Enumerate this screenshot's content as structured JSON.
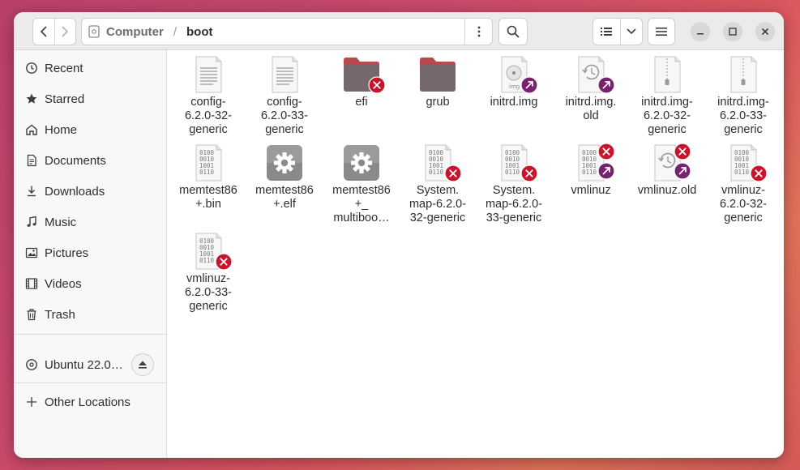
{
  "path": {
    "parent": "Computer",
    "current": "boot"
  },
  "sidebar": {
    "items": [
      {
        "label": "Recent",
        "icon": "clock-icon"
      },
      {
        "label": "Starred",
        "icon": "star-icon"
      },
      {
        "label": "Home",
        "icon": "home-icon"
      },
      {
        "label": "Documents",
        "icon": "document-icon"
      },
      {
        "label": "Downloads",
        "icon": "download-icon"
      },
      {
        "label": "Music",
        "icon": "music-note-icon"
      },
      {
        "label": "Pictures",
        "icon": "picture-icon"
      },
      {
        "label": "Videos",
        "icon": "film-icon"
      },
      {
        "label": "Trash",
        "icon": "trash-icon"
      }
    ],
    "drive": {
      "label": "Ubuntu 22.0…",
      "icon": "disc-icon"
    },
    "other": {
      "label": "Other Locations",
      "icon": "plus-icon"
    }
  },
  "files": [
    {
      "name": "config-\n6.2.0-32-\ngeneric",
      "type": "text"
    },
    {
      "name": "config-\n6.2.0-33-\ngeneric",
      "type": "text"
    },
    {
      "name": "efi",
      "type": "folder",
      "badges": [
        "unreadable"
      ]
    },
    {
      "name": "grub",
      "type": "folder",
      "badges": []
    },
    {
      "name": "initrd.img",
      "type": "image",
      "badges": [
        "symlink"
      ]
    },
    {
      "name": "initrd.img.\nold",
      "type": "backup",
      "badges": [
        "symlink"
      ]
    },
    {
      "name": "initrd.img-\n6.2.0-32-\ngeneric",
      "type": "archive"
    },
    {
      "name": "initrd.img-\n6.2.0-33-\ngeneric",
      "type": "archive"
    },
    {
      "name": "memtest86\n+.bin",
      "type": "binary"
    },
    {
      "name": "memtest86\n+.elf",
      "type": "executable"
    },
    {
      "name": "memtest86\n+_\nmultiboo…",
      "type": "executable"
    },
    {
      "name": "System.\nmap-6.2.0-\n32-generic",
      "type": "binary",
      "badges": [
        "unreadable"
      ]
    },
    {
      "name": "System.\nmap-6.2.0-\n33-generic",
      "type": "binary",
      "badges": [
        "unreadable"
      ]
    },
    {
      "name": "vmlinuz",
      "type": "binary",
      "badges": [
        "unreadable",
        "symlink"
      ]
    },
    {
      "name": "vmlinuz.old",
      "type": "backup",
      "badges": [
        "unreadable",
        "symlink"
      ]
    },
    {
      "name": "vmlinuz-\n6.2.0-32-\ngeneric",
      "type": "binary",
      "badges": [
        "unreadable"
      ]
    },
    {
      "name": "vmlinuz-\n6.2.0-33-\ngeneric",
      "type": "binary",
      "badges": [
        "unreadable"
      ]
    }
  ],
  "colors": {
    "unreadable_badge": "#c7162b",
    "symlink_badge": "#77216f",
    "folder_body": "#74686c",
    "folder_tab": "#b84a4f"
  }
}
